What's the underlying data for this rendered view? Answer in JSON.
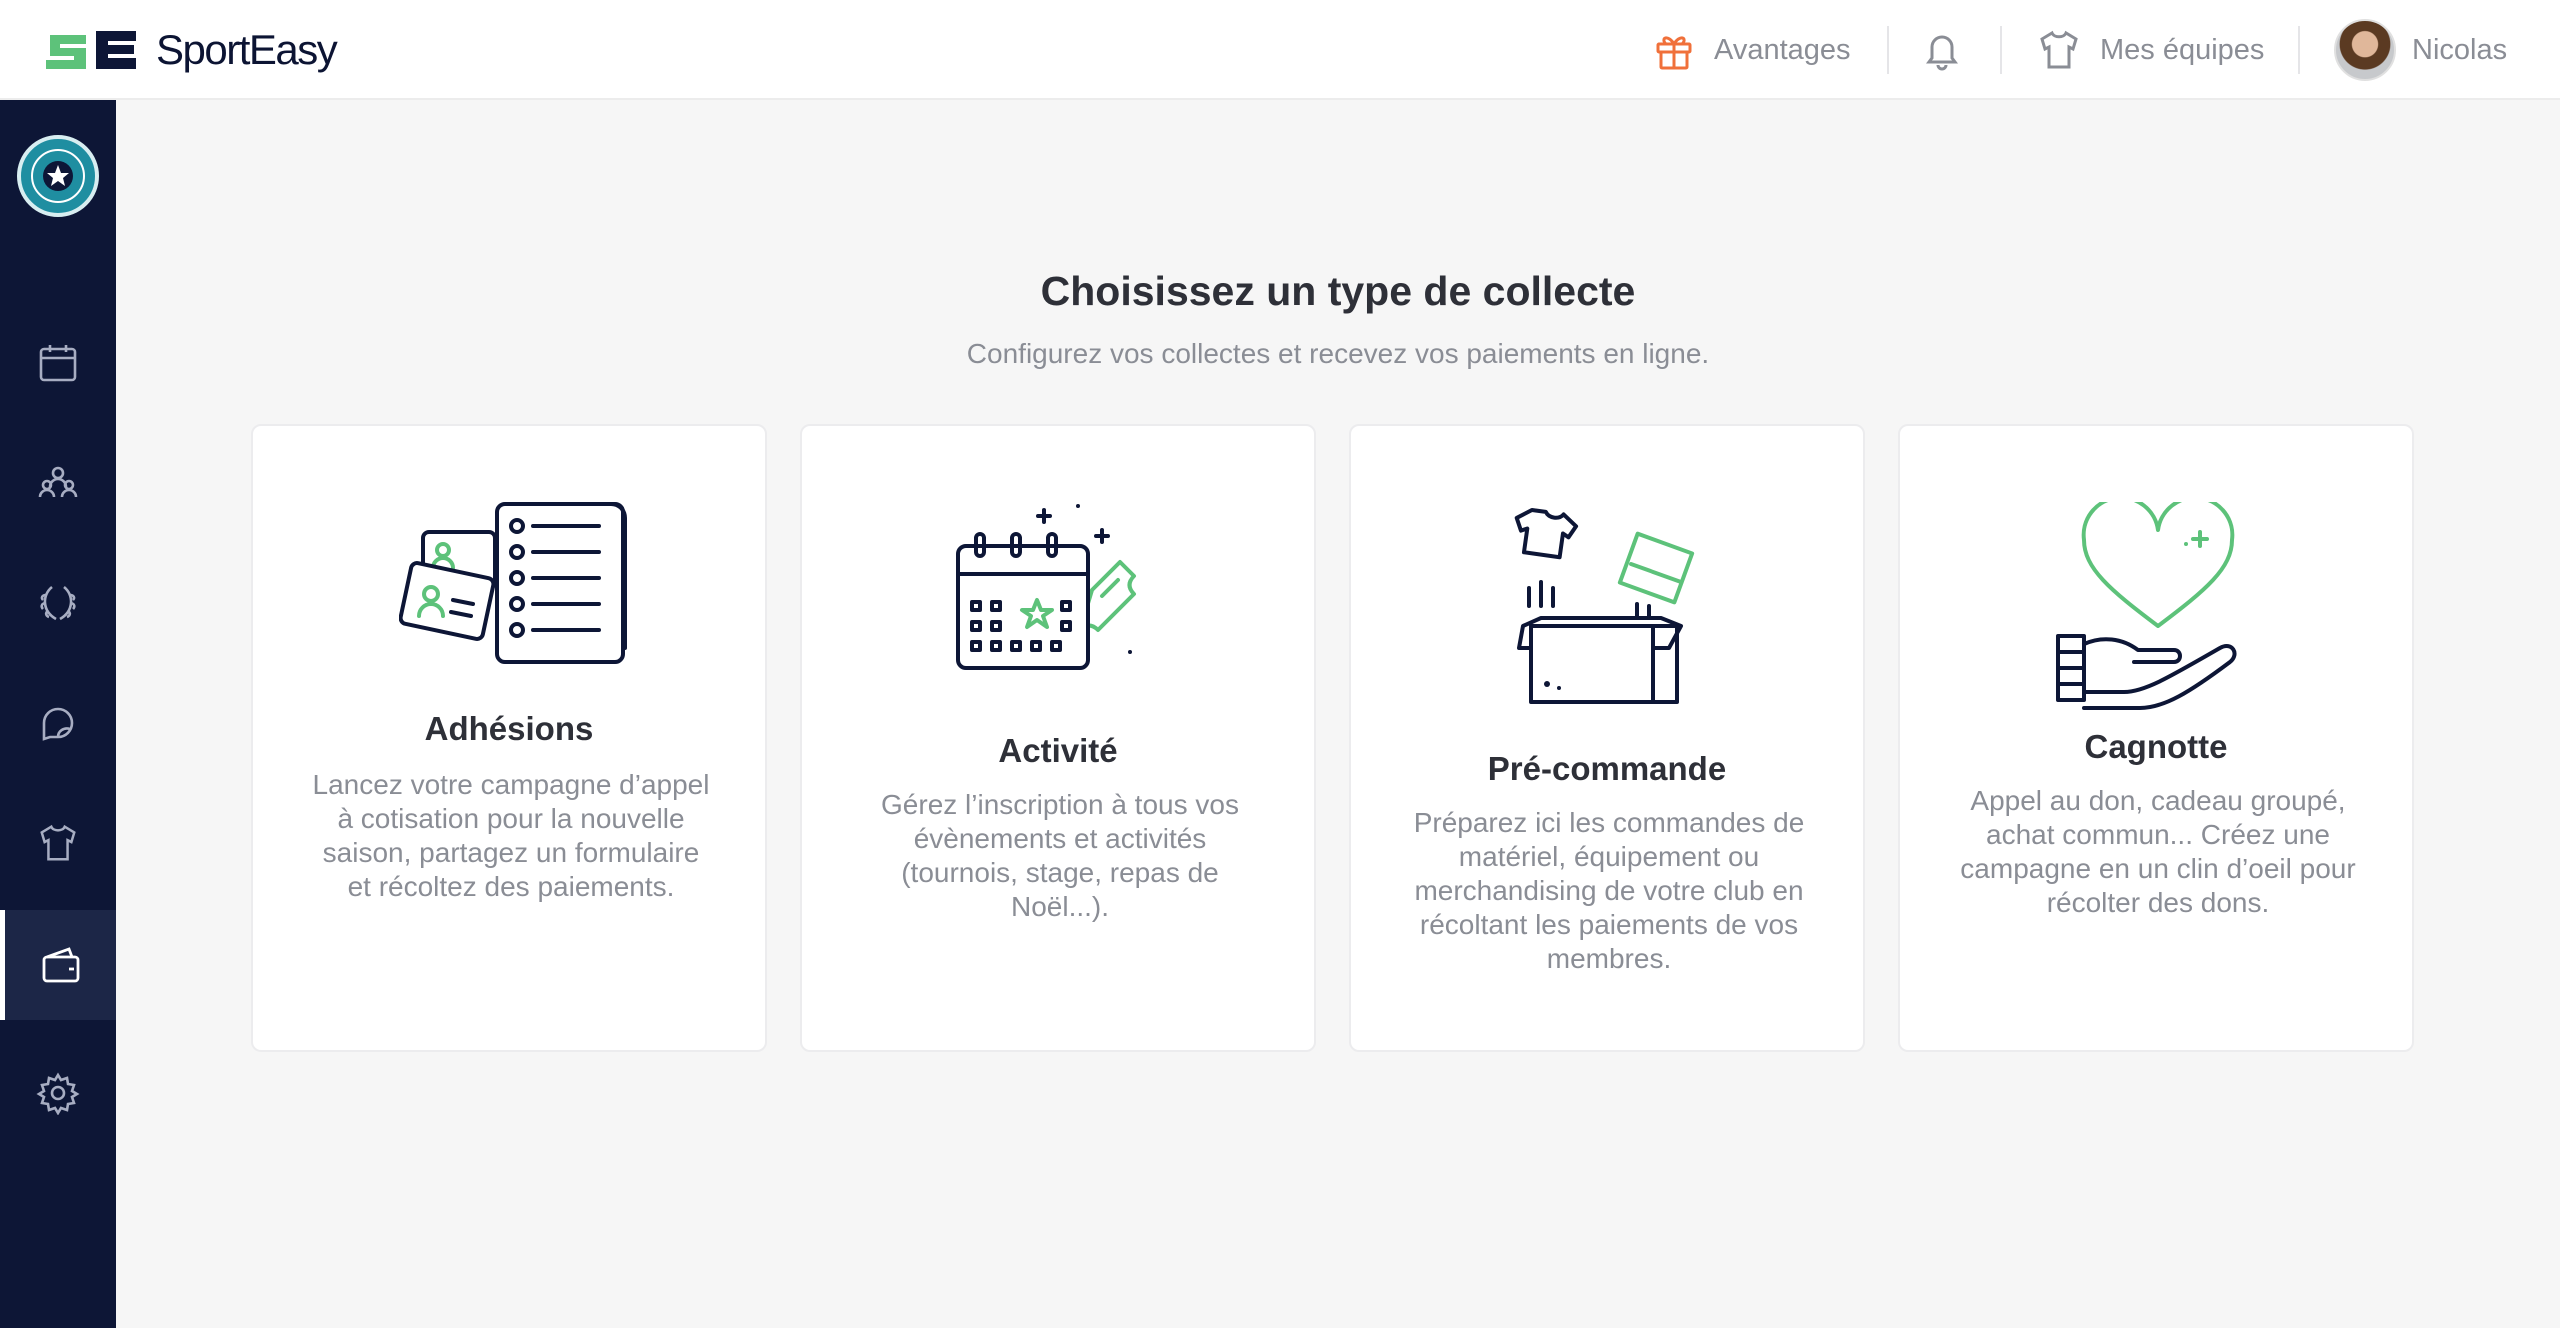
{
  "brand": {
    "name": "SportEasy"
  },
  "header": {
    "advantages_label": "Avantages",
    "teams_label": "Mes équipes",
    "user_name": "Nicolas"
  },
  "colors": {
    "accent": "#5dc27a",
    "navy": "#0d1636",
    "orange": "#f0703a"
  },
  "sidebar": {
    "items": [
      {
        "icon": "calendar-icon"
      },
      {
        "icon": "members-icon"
      },
      {
        "icon": "laurel-icon"
      },
      {
        "icon": "chat-icon"
      },
      {
        "icon": "tshirt-icon"
      },
      {
        "icon": "wallet-icon",
        "active": true
      },
      {
        "icon": "gear-icon"
      }
    ]
  },
  "main": {
    "title": "Choisissez un type de collecte",
    "subtitle": "Configurez vos collectes et recevez vos paiements en ligne."
  },
  "cards": [
    {
      "title": "Adhésions",
      "description": [
        "Lancez votre campagne d’appel",
        "à cotisation pour la nouvelle",
        "saison, partagez un formulaire",
        "et récoltez des paiements."
      ]
    },
    {
      "title": "Activité",
      "description": [
        "Gérez l’inscription à tous vos",
        "évènements et activités",
        "(tournois, stage, repas de",
        "Noël...)."
      ]
    },
    {
      "title": "Pré-commande",
      "description": [
        "Préparez ici les commandes de",
        "matériel, équipement ou",
        "merchandising de votre club en",
        "récoltant les paiements de vos",
        "membres."
      ]
    },
    {
      "title": "Cagnotte",
      "description": [
        "Appel au don, cadeau groupé,",
        "achat commun... Créez une",
        "campagne en un clin d’oeil pour",
        "récolter des dons."
      ]
    }
  ]
}
